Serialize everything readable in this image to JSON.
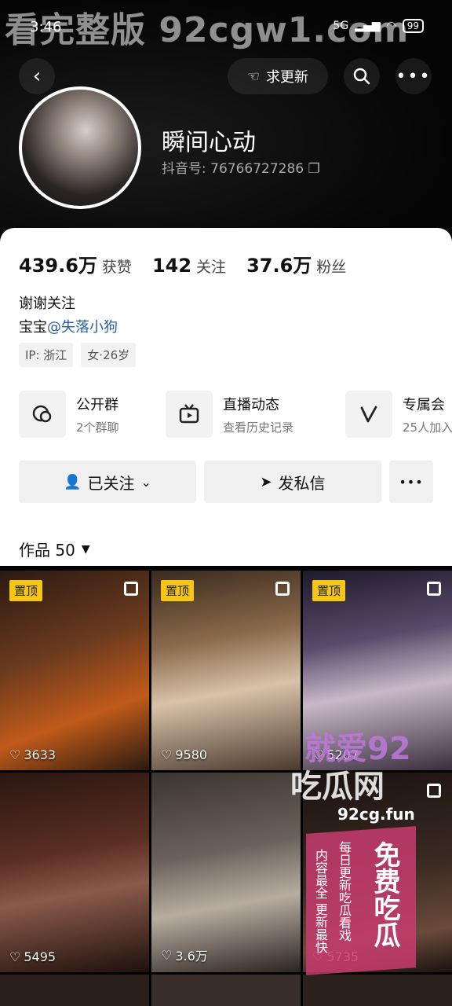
{
  "watermark": "看完整版 92cgw1.com",
  "status": {
    "time": "3:46",
    "network": "5G",
    "battery": "99"
  },
  "topbar": {
    "update_label": "求更新"
  },
  "profile": {
    "name": "瞬间心动",
    "id_label": "抖音号: 76766727286"
  },
  "stats": [
    {
      "value": "439.6万",
      "label": "获赞"
    },
    {
      "value": "142",
      "label": "关注"
    },
    {
      "value": "37.6万",
      "label": "粉丝"
    }
  ],
  "bio": {
    "line1": "谢谢关注",
    "line2_prefix": "宝宝",
    "line2_mention": "@失落小狗"
  },
  "tags": [
    "IP: 浙江",
    "女·26岁"
  ],
  "features": [
    {
      "title": "公开群",
      "sub": "2个群聊"
    },
    {
      "title": "直播动态",
      "sub": "查看历史记录"
    },
    {
      "title": "专属会",
      "sub": "25人加入"
    }
  ],
  "actions": {
    "follow": "已关注",
    "message": "发私信"
  },
  "works": {
    "label": "作品 50"
  },
  "videos": [
    {
      "pinned": true,
      "likes": "3633"
    },
    {
      "pinned": true,
      "likes": "9580"
    },
    {
      "pinned": true,
      "likes": "5207"
    },
    {
      "pinned": false,
      "likes": "5495"
    },
    {
      "pinned": false,
      "likes": "3.6万"
    },
    {
      "pinned": false,
      "likes": "5735"
    }
  ],
  "pin_label": "置顶",
  "ad": {
    "l1": "就爱92",
    "l2": "吃瓜网",
    "l3": "92cg.fun",
    "l4": "免费吃瓜",
    "l5": "每日更新吃瓜看戏",
    "l6": "内容最全 更新最快"
  },
  "colors": {
    "pin": "#f5c518",
    "mention": "#2a5fa8",
    "button_bg": "#f0f0f0"
  }
}
